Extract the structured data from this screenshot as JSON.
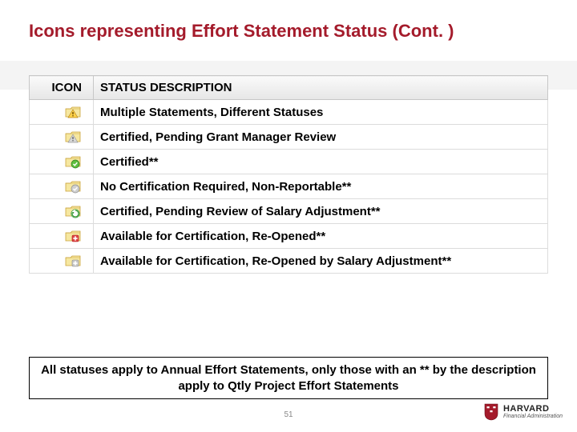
{
  "title": "Icons representing Effort Statement Status (Cont. )",
  "table": {
    "headers": {
      "icon": "ICON",
      "desc": "STATUS DESCRIPTION"
    },
    "rows": [
      {
        "icon": "folder-warn-gold",
        "desc": "Multiple Statements, Different Statuses"
      },
      {
        "icon": "folder-warn-grey",
        "desc": "Certified, Pending Grant Manager Review"
      },
      {
        "icon": "folder-check-green",
        "desc": "Certified**"
      },
      {
        "icon": "folder-check-grey",
        "desc": "No Certification Required, Non-Reportable**"
      },
      {
        "icon": "folder-recycle",
        "desc": "Certified, Pending Review of Salary Adjustment**"
      },
      {
        "icon": "folder-plus-red",
        "desc": "Available for Certification, Re-Opened**"
      },
      {
        "icon": "folder-plus-grey",
        "desc": "Available for Certification, Re-Opened by Salary Adjustment**"
      }
    ]
  },
  "note": "All statuses apply to Annual Effort Statements, only those with an ** by the description apply to Qtly Project Effort Statements",
  "page_number": "51",
  "brand": {
    "name": "HARVARD",
    "sub": "Financial Administration"
  }
}
